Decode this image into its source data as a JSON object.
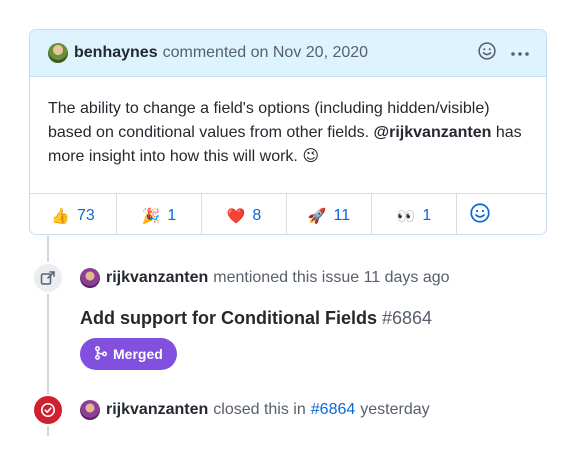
{
  "comment": {
    "author": "benhaynes",
    "action": "commented on Nov 20, 2020",
    "body_prefix": "The ability to change a field's options (including hidden/visible) based on conditional values from other fields.",
    "mention": "@rijkvanzanten",
    "body_suffix": "has more insight into how this will work. 😉",
    "reactions": [
      {
        "emoji": "👍",
        "count": "73"
      },
      {
        "emoji": "🎉",
        "count": "1"
      },
      {
        "emoji": "❤️",
        "count": "8"
      },
      {
        "emoji": "🚀",
        "count": "11"
      },
      {
        "emoji": "👀",
        "count": "1"
      }
    ]
  },
  "mention_event": {
    "author": "rijkvanzanten",
    "text": "mentioned this issue 11 days ago",
    "pr_title": "Add support for Conditional Fields",
    "pr_number": "#6864",
    "status": "Merged"
  },
  "close_event": {
    "author": "rijkvanzanten",
    "text_before": "closed this in",
    "pr_link": "#6864",
    "text_after": "yesterday"
  },
  "colors": {
    "header_bg": "#ddf4ff",
    "link": "#0969da",
    "merged": "#8250df",
    "closed": "#cf222e"
  },
  "icons": [
    "smiley-icon",
    "kebab-menu-icon",
    "cross-reference-icon",
    "git-merge-icon",
    "issue-closed-icon",
    "add-reaction-icon"
  ]
}
